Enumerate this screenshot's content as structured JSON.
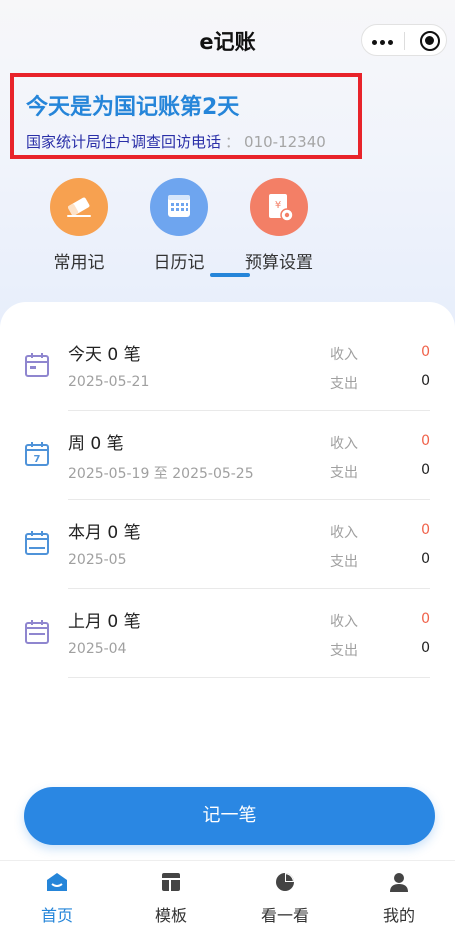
{
  "nav": {
    "title": "e记账"
  },
  "banner": {
    "title": "今天是为国记账第2天",
    "subtitle": "国家统计局住户调查回访电话",
    "separator": "：",
    "phone": "010-12340"
  },
  "quick_actions": [
    {
      "label": "常用记",
      "icon": "eraser-icon",
      "color": "#f7a150"
    },
    {
      "label": "日历记",
      "icon": "calendar-icon",
      "color": "#6ea5ef"
    },
    {
      "label": "预算设置",
      "icon": "budget-icon",
      "color": "#f37f66"
    }
  ],
  "summary": {
    "income_label": "收入",
    "expense_label": "支出",
    "rows": [
      {
        "title": "今天 0 笔",
        "date": "2025-05-21",
        "income": "0",
        "expense": "0",
        "icon": "calendar-today-icon",
        "icon_color": "#8f86cf"
      },
      {
        "title": "周 0 笔",
        "date": "2025-05-19 至 2025-05-25",
        "income": "0",
        "expense": "0",
        "icon": "calendar-week-icon",
        "icon_color": "#4f93d9"
      },
      {
        "title": "本月 0 笔",
        "date": "2025-05",
        "income": "0",
        "expense": "0",
        "icon": "calendar-month-icon",
        "icon_color": "#4f93d9"
      },
      {
        "title": "上月 0 笔",
        "date": "2025-04",
        "income": "0",
        "expense": "0",
        "icon": "calendar-lastmonth-icon",
        "icon_color": "#8f86cf"
      }
    ]
  },
  "record_button": "记一笔",
  "tabbar": [
    {
      "label": "首页",
      "icon": "home-icon",
      "active": true
    },
    {
      "label": "模板",
      "icon": "template-icon",
      "active": false
    },
    {
      "label": "看一看",
      "icon": "pie-chart-icon",
      "active": false
    },
    {
      "label": "我的",
      "icon": "user-icon",
      "active": false
    }
  ],
  "colors": {
    "accent": "#2585d9",
    "income": "#f0624a",
    "banner_border": "#e8232a"
  }
}
